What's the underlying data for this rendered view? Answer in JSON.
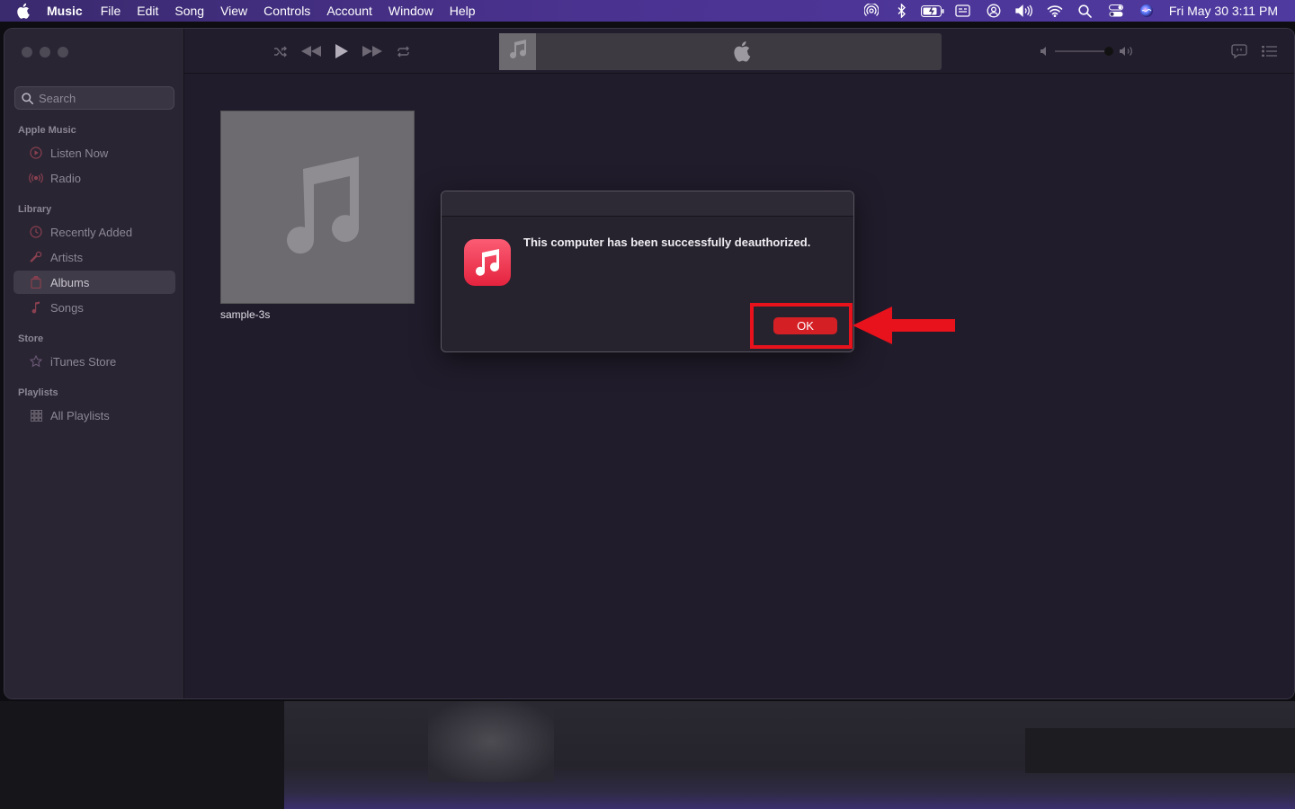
{
  "menubar": {
    "app_name": "Music",
    "items": [
      "File",
      "Edit",
      "Song",
      "View",
      "Controls",
      "Account",
      "Window",
      "Help"
    ],
    "clock": "Fri May 30  3:11 PM",
    "status_icons": [
      "airdrop-icon",
      "bluetooth-icon",
      "battery-icon",
      "display-icon",
      "user-icon",
      "volume-icon",
      "wifi-icon",
      "spotlight-icon",
      "control-center-icon",
      "siri-icon"
    ]
  },
  "sidebar": {
    "search_placeholder": "Search",
    "sections": {
      "apple_music": {
        "title": "Apple Music",
        "items": [
          "Listen Now",
          "Radio"
        ]
      },
      "library": {
        "title": "Library",
        "items": [
          "Recently Added",
          "Artists",
          "Albums",
          "Songs"
        ]
      },
      "store": {
        "title": "Store",
        "items": [
          "iTunes Store"
        ]
      },
      "playlists": {
        "title": "Playlists",
        "items": [
          "All Playlists"
        ]
      }
    },
    "selected_item": "Albums"
  },
  "main": {
    "albums": [
      {
        "title": "sample-3s"
      }
    ]
  },
  "dialog": {
    "message": "This computer has been successfully deauthorized.",
    "ok_label": "OK"
  },
  "colors": {
    "accent_red": "#d41f25",
    "annotation_red": "#e8121c",
    "music_icon_gradient_top": "#fb5c74",
    "music_icon_gradient_bottom": "#e5233e",
    "sidebar_icon_red": "#8a4050"
  }
}
